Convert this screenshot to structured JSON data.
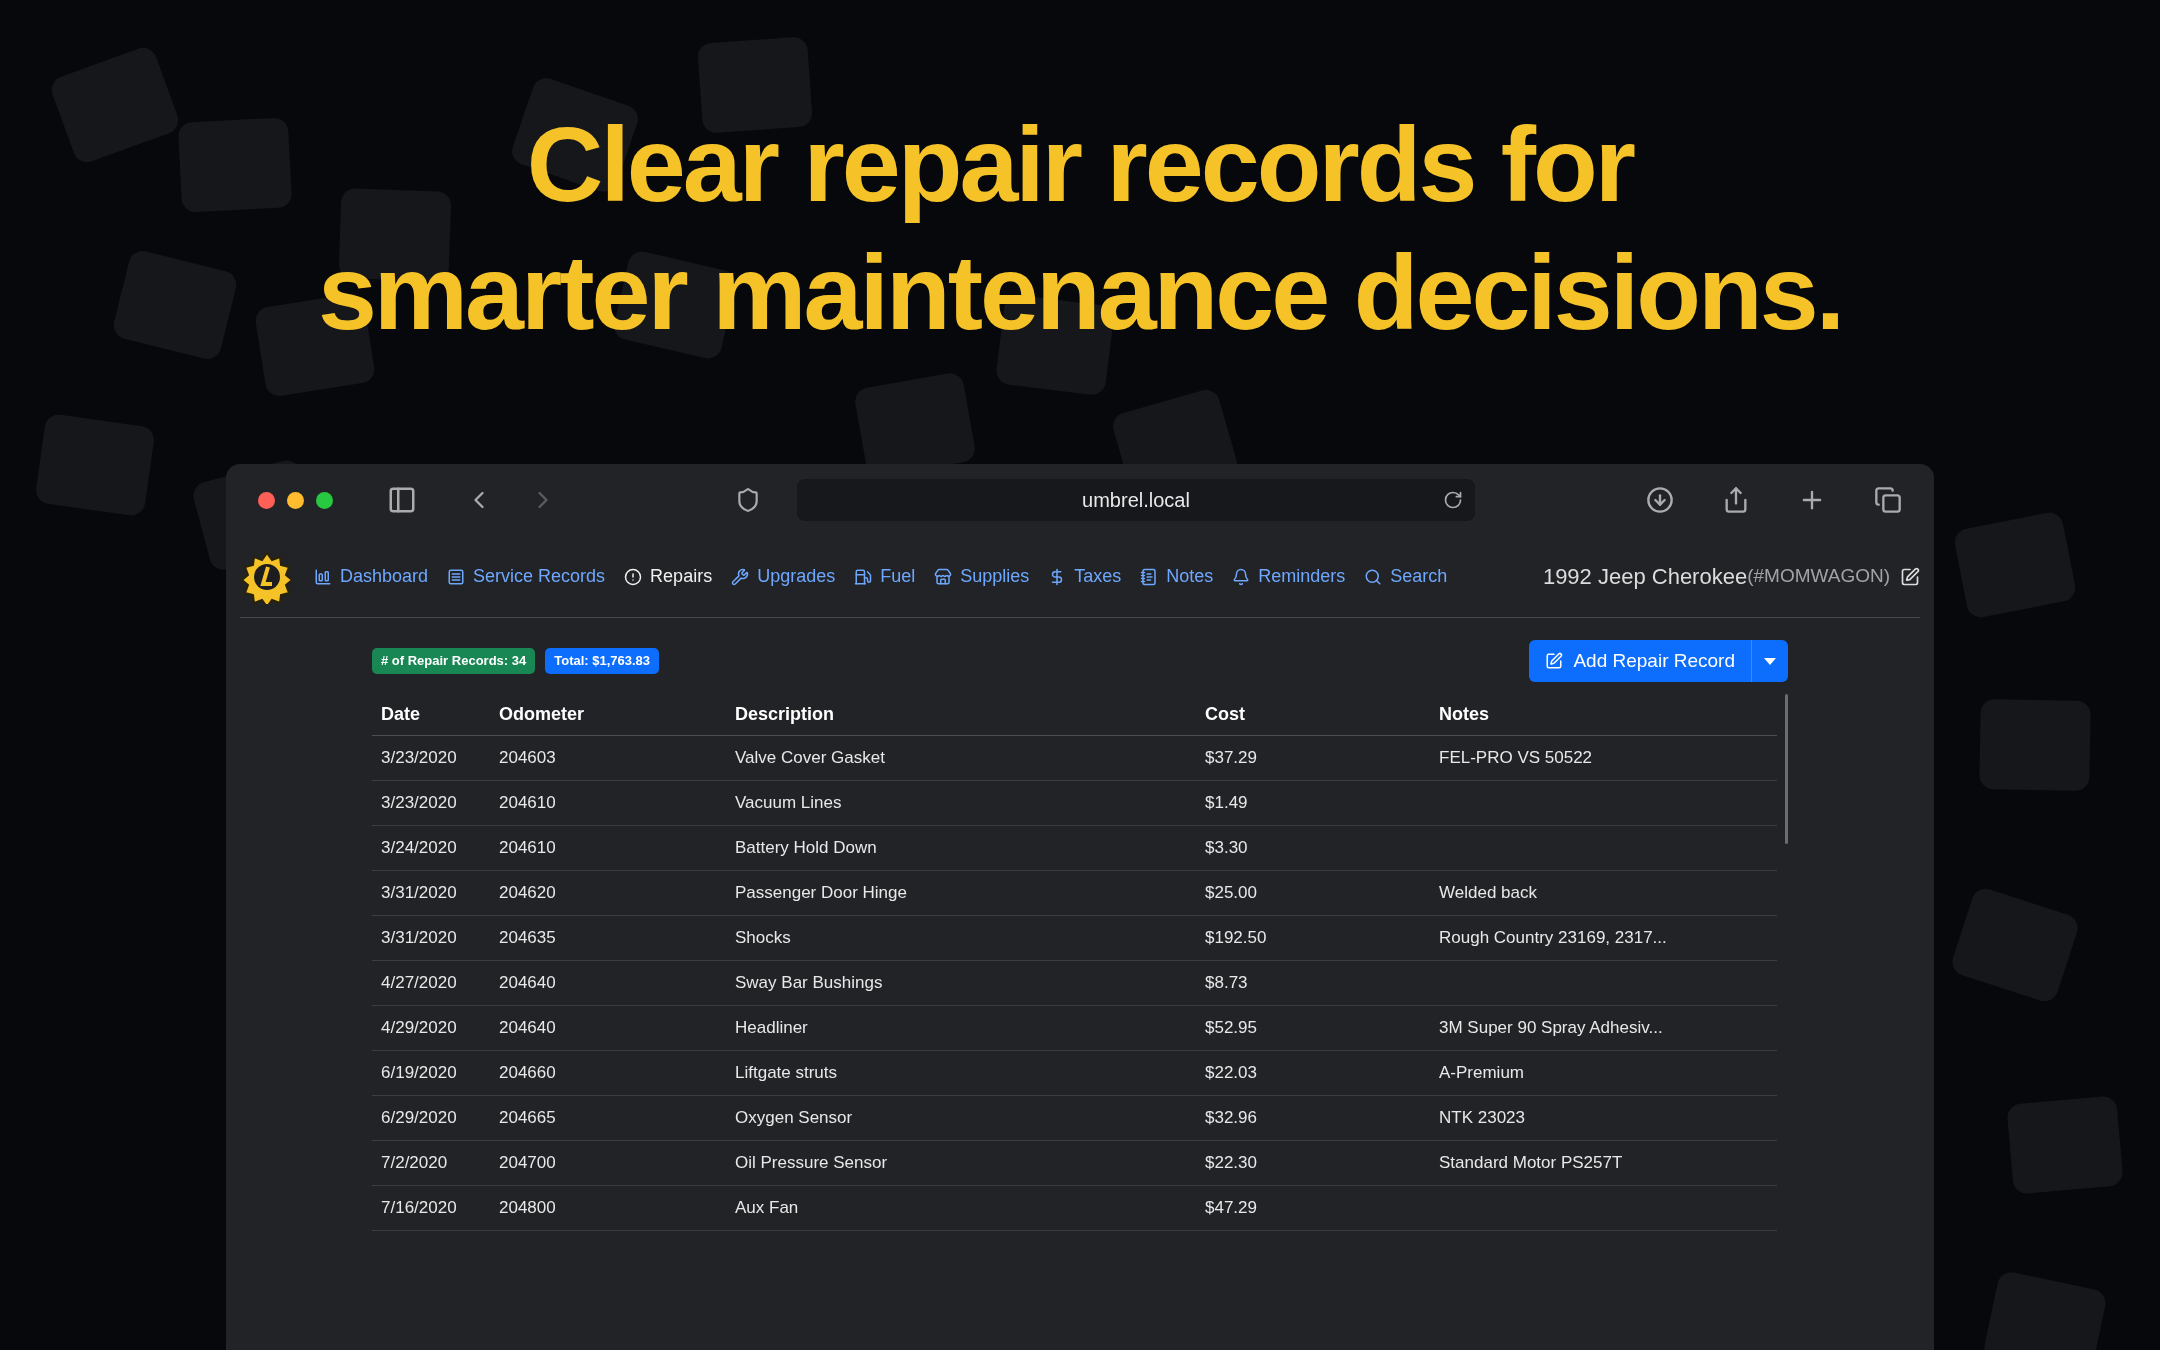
{
  "headline": "Clear repair records for\nsmarter maintenance decisions.",
  "browser": {
    "url": "umbrel.local"
  },
  "nav": {
    "items": [
      {
        "label": "Dashboard",
        "selected": false
      },
      {
        "label": "Service Records",
        "selected": false
      },
      {
        "label": "Repairs",
        "selected": true
      },
      {
        "label": "Upgrades",
        "selected": false
      },
      {
        "label": "Fuel",
        "selected": false
      },
      {
        "label": "Supplies",
        "selected": false
      },
      {
        "label": "Taxes",
        "selected": false
      },
      {
        "label": "Notes",
        "selected": false
      },
      {
        "label": "Reminders",
        "selected": false
      },
      {
        "label": "Search",
        "selected": false
      }
    ],
    "vehicle": "1992 Jeep Cherokee",
    "vehicle_tag": "(#MOMWAGON)"
  },
  "badges": [
    {
      "label": "# of Repair Records: 34",
      "color": "#198754"
    },
    {
      "label": "Total: $1,763.83",
      "color": "#0d6efd"
    }
  ],
  "add_button": "Add Repair Record",
  "table": {
    "columns": [
      "Date",
      "Odometer",
      "Description",
      "Cost",
      "Notes"
    ],
    "rows": [
      {
        "date": "3/23/2020",
        "odometer": "204603",
        "description": "Valve Cover Gasket",
        "cost": "$37.29",
        "notes": "FEL-PRO VS 50522"
      },
      {
        "date": "3/23/2020",
        "odometer": "204610",
        "description": "Vacuum Lines",
        "cost": "$1.49"
      },
      {
        "date": "3/24/2020",
        "odometer": "204610",
        "description": "Battery Hold Down",
        "cost": "$3.30"
      },
      {
        "date": "3/31/2020",
        "odometer": "204620",
        "description": "Passenger Door Hinge",
        "cost": "$25.00",
        "notes": "Welded back"
      },
      {
        "date": "3/31/2020",
        "odometer": "204635",
        "description": "Shocks",
        "cost": "$192.50",
        "notes": "Rough Country 23169, 2317..."
      },
      {
        "date": "4/27/2020",
        "odometer": "204640",
        "description": "Sway Bar Bushings",
        "cost": "$8.73"
      },
      {
        "date": "4/29/2020",
        "odometer": "204640",
        "description": "Headliner",
        "cost": "$52.95",
        "notes": "3M Super 90 Spray Adhesiv..."
      },
      {
        "date": "6/19/2020",
        "odometer": "204660",
        "description": "Liftgate struts",
        "cost": "$22.03",
        "notes": "A-Premium"
      },
      {
        "date": "6/29/2020",
        "odometer": "204665",
        "description": "Oxygen Sensor",
        "cost": "$32.96",
        "notes": "NTK 23023"
      },
      {
        "date": "7/2/2020",
        "odometer": "204700",
        "description": "Oil Pressure Sensor",
        "cost": "$22.30",
        "notes": "Standard Motor PS257T"
      },
      {
        "date": "7/16/2020",
        "odometer": "204800",
        "description": "Aux Fan",
        "cost": "$47.29"
      }
    ]
  }
}
